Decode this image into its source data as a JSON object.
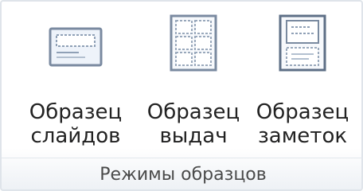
{
  "group": {
    "title": "Режимы образцов"
  },
  "buttons": [
    {
      "line1": "Образец",
      "line2": "слайдов",
      "icon": "slide-master-icon"
    },
    {
      "line1": "Образец",
      "line2": "выдач",
      "icon": "handout-master-icon"
    },
    {
      "line1": "Образец",
      "line2": "заметок",
      "icon": "notes-master-icon"
    }
  ],
  "colors": {
    "icon_stroke": "#7a8aa0",
    "icon_fill": "#eef3fa",
    "text": "#222222"
  }
}
